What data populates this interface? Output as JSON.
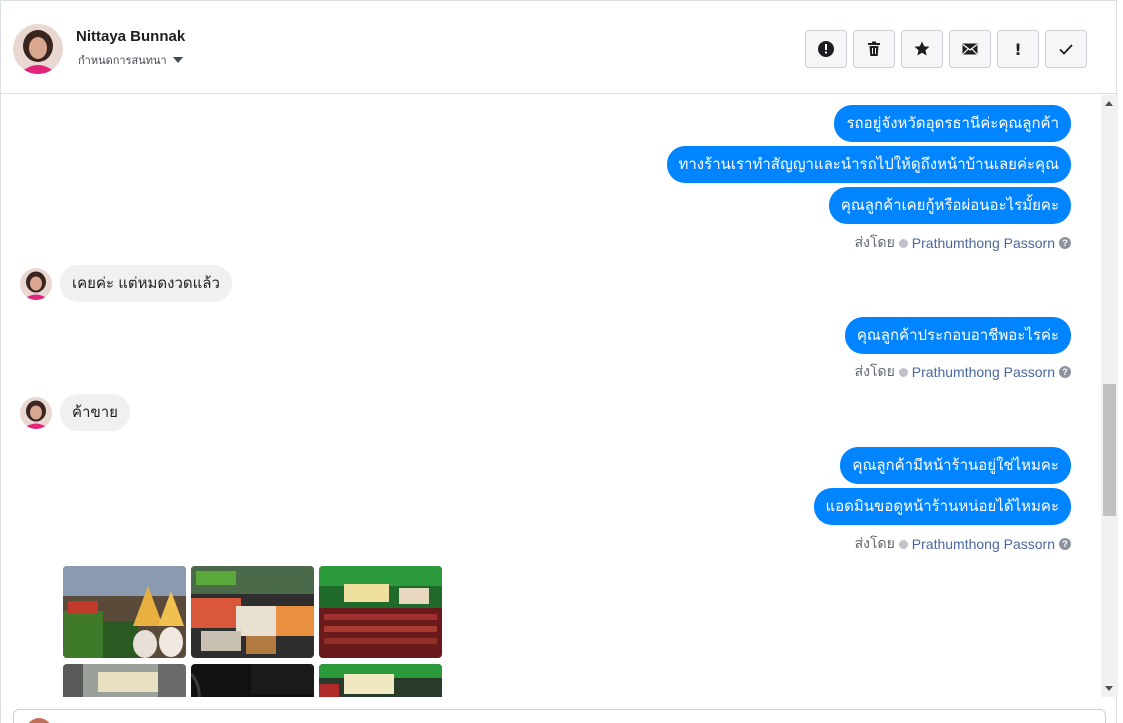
{
  "header": {
    "contact_name": "Nittaya Bunnak",
    "assign_label": "กำหนดการสนทนา",
    "actions": [
      {
        "name": "spam-button",
        "icon": "alert-circle-icon"
      },
      {
        "name": "delete-button",
        "icon": "trash-icon"
      },
      {
        "name": "star-button",
        "icon": "star-icon"
      },
      {
        "name": "mark-unread-button",
        "icon": "envelope-icon"
      },
      {
        "name": "follow-up-button",
        "icon": "exclamation-icon"
      },
      {
        "name": "mark-done-button",
        "icon": "check-icon"
      }
    ]
  },
  "thread": {
    "messages": [
      {
        "dir": "out",
        "text": "รถอยู่จังหวัดอุดรธานีค่ะคุณลูกค้า"
      },
      {
        "dir": "out",
        "text": "ทางร้านเราทำสัญญาและนำรถไปให้ดูถึงหน้าบ้านเลยค่ะคุณ"
      },
      {
        "dir": "out",
        "text": "คุณลูกค้าเคยกู้หรือผ่อนอะไรมั้ยคะ"
      },
      {
        "dir": "in",
        "text": "เคยค่ะ แต่หมดงวดแล้ว"
      },
      {
        "dir": "out",
        "text": "คุณลูกค้าประกอบอาชีพอะไรค่ะ"
      },
      {
        "dir": "in",
        "text": "ค้าขาย"
      },
      {
        "dir": "out",
        "text": "คุณลูกค้ามีหน้าร้านอยู่ใช่ไหมคะ"
      },
      {
        "dir": "out",
        "text": "แอดมินขอดูหน้าร้านหน่อยได้ไหมคะ"
      }
    ],
    "sent_by_label": "ส่งโดย",
    "agent_name": "Prathumthong Passorn"
  },
  "colors": {
    "outgoing_bubble": "#0084ff",
    "incoming_bubble": "#f1f0f0",
    "agent_link": "#4b67a1"
  }
}
